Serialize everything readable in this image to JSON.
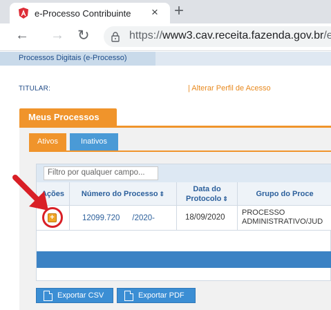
{
  "browser": {
    "tab_title": "e-Processo Contribuinte",
    "tab_close": "×",
    "new_tab": "+",
    "back": "←",
    "forward": "→",
    "reload": "↻",
    "url_prefix": "https://",
    "url_host": "www3.cav.receita.fazenda.gov.br",
    "url_path": "/ep"
  },
  "header": {
    "brand": "Processos Digitais (e-Processo)",
    "titular_label": "TITULAR:",
    "perfil_link": "| Alterar Perfil de Acesso"
  },
  "main": {
    "section_title": "Meus Processos",
    "tabs": [
      {
        "label": "Ativos",
        "active": true
      },
      {
        "label": "Inativos",
        "active": false
      }
    ],
    "filter_placeholder": "Filtro por qualquer campo...",
    "columns": {
      "acoes": "Ações",
      "numero": "Número do Processo",
      "data_line1": "Data do",
      "data_line2": "Protocolo",
      "grupo": "Grupo do Proce"
    },
    "sort_glyph": "⇕",
    "rows": [
      {
        "numero_a": "12099.720",
        "numero_b": "/2020-",
        "data": "18/09/2020",
        "grupo_line1": "PROCESSO",
        "grupo_line2": "ADMINISTRATIVO/JUD"
      }
    ],
    "add_glyph": "+",
    "export_csv": "Exportar CSV",
    "export_pdf": "Exportar PDF"
  },
  "colors": {
    "accent_orange": "#f0942b",
    "blue_tab": "#4a9ad6",
    "annotation_red": "#d91f26"
  }
}
